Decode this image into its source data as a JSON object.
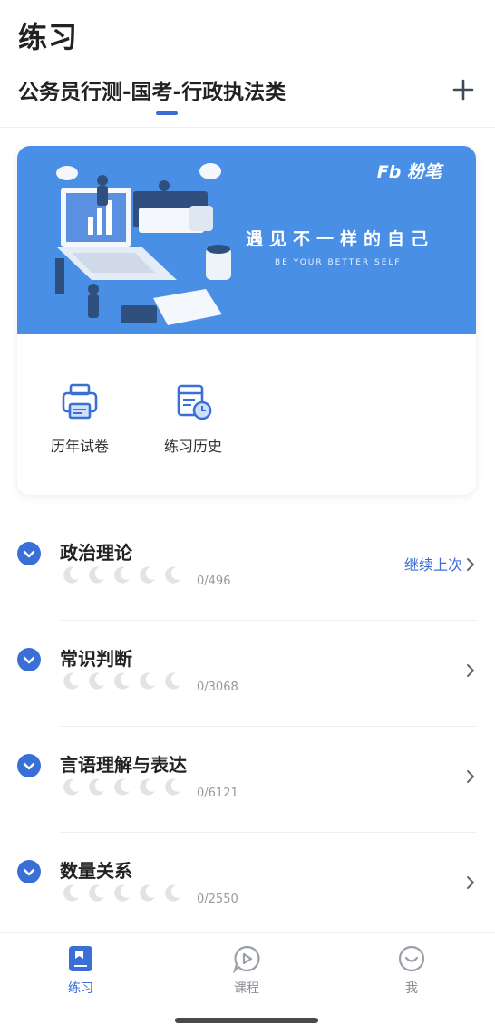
{
  "header": {
    "title": "练习",
    "subject": "公务员行测-国考-行政执法类"
  },
  "banner": {
    "brand": "Fb 粉笔",
    "title": "遇见不一样的自己",
    "subtitle": "BE YOUR BETTER SELF"
  },
  "quick_actions": [
    {
      "label": "历年试卷",
      "icon": "printer-icon"
    },
    {
      "label": "练习历史",
      "icon": "history-icon"
    }
  ],
  "sections": [
    {
      "title": "政治理论",
      "count": "0/496",
      "action": "继续上次"
    },
    {
      "title": "常识判断",
      "count": "0/3068"
    },
    {
      "title": "言语理解与表达",
      "count": "0/6121"
    },
    {
      "title": "数量关系",
      "count": "0/2550"
    }
  ],
  "tabs": [
    {
      "label": "练习",
      "icon": "book-icon",
      "active": true
    },
    {
      "label": "课程",
      "icon": "play-icon",
      "active": false
    },
    {
      "label": "我",
      "icon": "smile-icon",
      "active": false
    }
  ],
  "colors": {
    "accent": "#3b6fd8",
    "banner": "#4a8fe6",
    "moon": "#e3e3e3"
  }
}
